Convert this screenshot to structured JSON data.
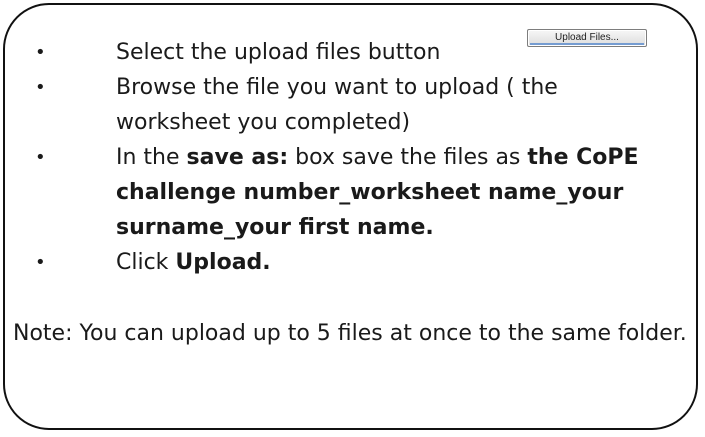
{
  "upload_button": {
    "label": "Upload Files..."
  },
  "steps": [
    {
      "text": "Select the upload files button"
    },
    {
      "text": "Browse the file you want to upload ( the worksheet you completed)"
    },
    {
      "prefix": "In the ",
      "bold1": "save as:",
      "middle": " box save the files as ",
      "bold2": "the CoPE challenge number_worksheet name_your surname_your first name."
    },
    {
      "prefix": "Click ",
      "bold1": "Upload."
    }
  ],
  "note": "Note: You can upload up to 5 files at once to the same folder."
}
